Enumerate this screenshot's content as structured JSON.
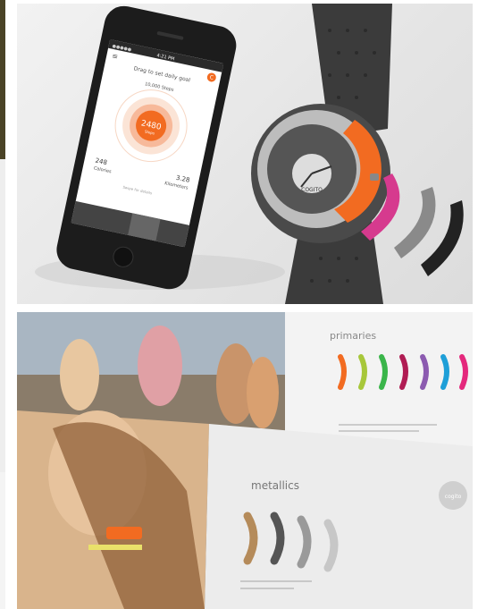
{
  "phone": {
    "status_carrier": "●●●●● ",
    "status_time": "4:21 PM",
    "prompt": "Drag to set daily goal",
    "goal": "10,000 Steps",
    "steps_value": "2480",
    "steps_unit": "Steps",
    "calories_value": "248",
    "calories_label": "Calories",
    "km_value": "3.28",
    "km_label": "Kilometers",
    "swipe_hint": "Swipe for details",
    "logo_letter": "C"
  },
  "watch": {
    "brand": "COGITO"
  },
  "brochure": {
    "primaries_title": "primaries",
    "metallics_title": "metallics",
    "badge": "cogito"
  },
  "colors": {
    "accent_orange": "#f26b21",
    "watch_body": "#3d3d3d"
  }
}
